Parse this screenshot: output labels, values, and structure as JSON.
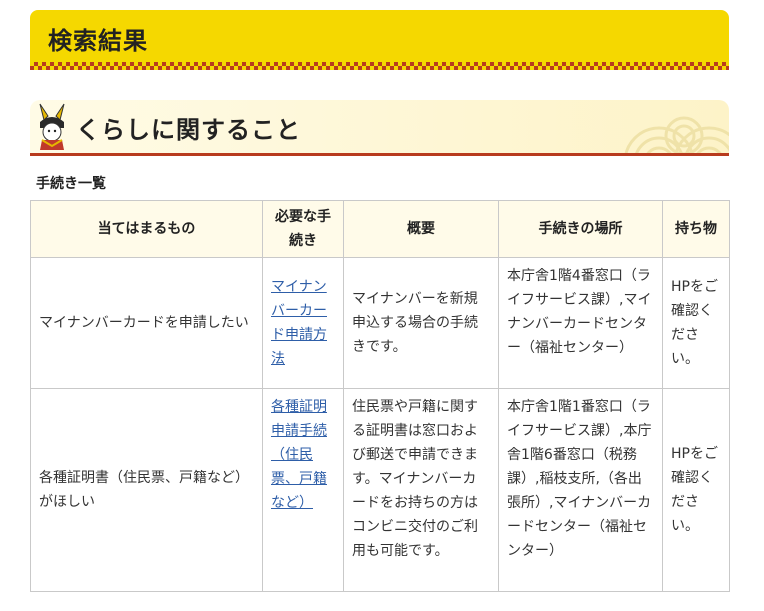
{
  "banner": {
    "title": "検索結果"
  },
  "section": {
    "heading": "くらしに関すること"
  },
  "subtitle": "手続き一覧",
  "table": {
    "headers": [
      "当てはまるもの",
      "必要な手続き",
      "概要",
      "手続きの場所",
      "持ち物"
    ],
    "rows": [
      {
        "situation": "マイナンバーカードを申請したい",
        "procedure": "マイナンバーカード申請方法",
        "summary": "マイナンバーを新規申込する場合の手続きです。",
        "location": "本庁舎1階4番窓口（ライフサービス課）,マイナンバーカードセンター（福祉センター）",
        "items": "HPをご確認ください。"
      },
      {
        "situation": "各種証明書（住民票、戸籍など）がほしい",
        "procedure": "各種証明申請手続（住民票、戸籍など）",
        "summary": "住民票や戸籍に関する証明書は窓口および郵送で申請できます。マイナンバーカードをお持ちの方はコンビニ交付のご利用も可能です。",
        "location": "本庁舎1階1番窓口（ライフサービス課）,本庁舎1階6番窓口（税務課）,稲枝支所,（各出張所）,マイナンバーカードセンター（福祉センター）",
        "items": "HPをご確認ください。"
      }
    ]
  },
  "colors": {
    "banner": "#f5d800",
    "accent_red": "#b83b1e",
    "link": "#2e5ea8"
  }
}
